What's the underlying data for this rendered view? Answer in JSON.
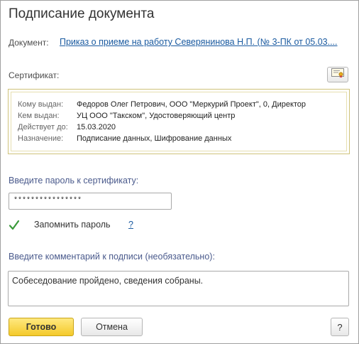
{
  "window": {
    "title": "Подписание документа"
  },
  "document": {
    "label": "Документ:",
    "link_text": "Приказ о приеме на работу Северянинова Н.П. (№ 3-ПК от 05.03...."
  },
  "certificate": {
    "label": "Сертификат:",
    "select_icon": "certificate-icon",
    "rows": [
      {
        "key": "Кому выдан:",
        "value": "Федоров Олег Петрович, ООО \"Меркурий Проект\", 0, Директор"
      },
      {
        "key": "Кем выдан:",
        "value": "УЦ ООО \"Такском\", Удостоверяющий центр"
      },
      {
        "key": "Действует до:",
        "value": "15.03.2020"
      },
      {
        "key": "Назначение:",
        "value": "Подписание данных, Шифрование данных"
      }
    ]
  },
  "password": {
    "label": "Введите пароль к сертификату:",
    "value": "****************"
  },
  "remember": {
    "checked": true,
    "label": "Запомнить пароль",
    "help_text": "?"
  },
  "comment": {
    "label": "Введите комментарий к подписи (необязательно):",
    "value": "Собеседование пройдено, сведения собраны."
  },
  "buttons": {
    "ok_label": "Готово",
    "cancel_label": "Отмена",
    "help_label": "?"
  },
  "colors": {
    "accent_button": "#f4c92a",
    "link": "#1a5aa0",
    "field_label": "#4a5a8c",
    "checkmark": "#3a9a3a",
    "cert_border": "#cfc27a"
  }
}
